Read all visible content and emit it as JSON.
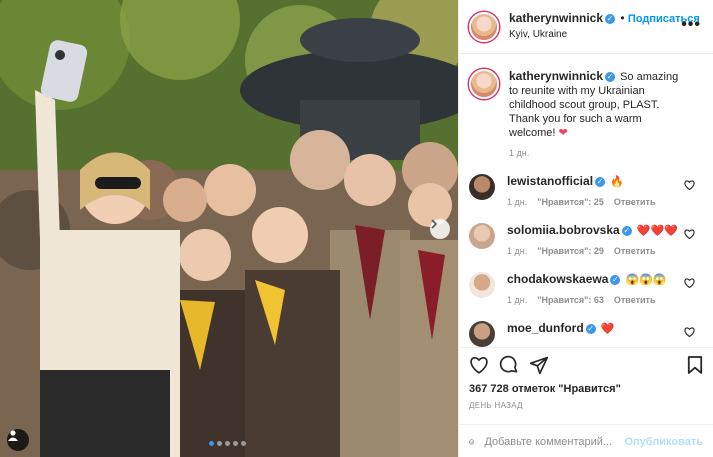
{
  "post": {
    "username": "katherynwinnick",
    "follow_label": "Подписаться",
    "location": "Kyiv, Ukraine",
    "more_icon": "more-horizontal-icon",
    "caption": "So amazing to reunite with my Ukrainian childhood scout group, PLAST. Thank you for such a warm welcome!",
    "caption_time": "1 дн.",
    "likes": "367 728 отметок \"Нравится\"",
    "date": "ДЕНЬ НАЗАД",
    "comment_placeholder": "Добавьте комментарий...",
    "publish_label": "Опубликовать"
  },
  "comments": [
    {
      "user": "lewistanofficial",
      "text": "🔥",
      "time": "1 дн.",
      "likes": "\"Нравится\": 25",
      "reply": "Ответить"
    },
    {
      "user": "solomiia.bobrovska",
      "text": "❤️❤️❤️",
      "time": "1 дн.",
      "likes": "\"Нравится\": 29",
      "reply": "Ответить"
    },
    {
      "user": "chodakowskaewa",
      "text": "😱😱😱",
      "time": "1 дн.",
      "likes": "\"Нравится\": 63",
      "reply": "Ответить"
    },
    {
      "user": "moe_dunford",
      "text": "❤️",
      "time": "",
      "likes": "",
      "reply": ""
    }
  ],
  "carousel": {
    "total": 5,
    "current": 1
  },
  "colors": {
    "accent": "#0095f6",
    "verified": "#3897f0",
    "muted": "#8e8e8e",
    "heart": "#ed4956"
  }
}
